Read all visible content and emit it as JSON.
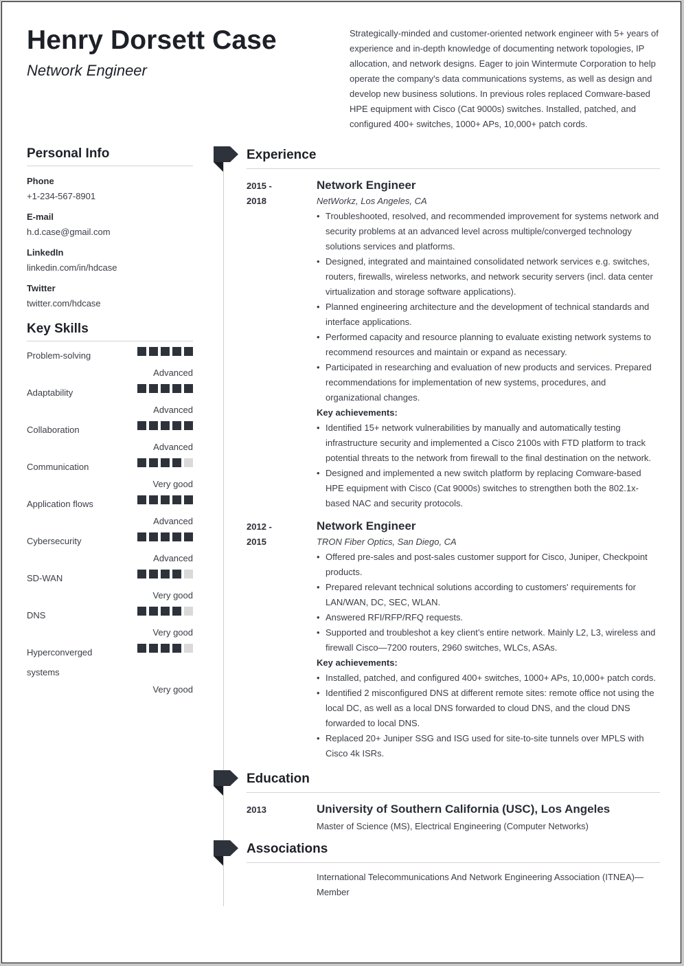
{
  "header": {
    "name": "Henry Dorsett Case",
    "title": "Network Engineer",
    "summary": "Strategically-minded and customer-oriented network engineer with 5+ years of experience and in-depth knowledge of documenting network topologies, IP allocation, and network designs. Eager to join Wintermute Corporation to help operate the company's data communications systems, as well as design and develop new business solutions. In previous roles replaced Comware-based HPE equipment with Cisco (Cat 9000s) switches. Installed, patched, and configured 400+ switches, 1000+ APs, 10,000+ patch cords."
  },
  "personal_info": {
    "heading": "Personal Info",
    "items": [
      {
        "label": "Phone",
        "value": "+1-234-567-8901"
      },
      {
        "label": "E-mail",
        "value": "h.d.case@gmail.com"
      },
      {
        "label": "LinkedIn",
        "value": "linkedin.com/in/hdcase"
      },
      {
        "label": "Twitter",
        "value": "twitter.com/hdcase"
      }
    ]
  },
  "skills": {
    "heading": "Key Skills",
    "max_level": 5,
    "items": [
      {
        "name": "Problem-solving",
        "level": 5,
        "label": "Advanced"
      },
      {
        "name": "Adaptability",
        "level": 5,
        "label": "Advanced"
      },
      {
        "name": "Collaboration",
        "level": 5,
        "label": "Advanced"
      },
      {
        "name": "Communication",
        "level": 4,
        "label": "Very good"
      },
      {
        "name": "Application flows",
        "level": 5,
        "label": "Advanced"
      },
      {
        "name": "Cybersecurity",
        "level": 5,
        "label": "Advanced"
      },
      {
        "name": "SD-WAN",
        "level": 4,
        "label": "Very good"
      },
      {
        "name": "DNS",
        "level": 4,
        "label": "Very good"
      },
      {
        "name": "Hyperconverged systems",
        "level": 4,
        "label": "Very good"
      }
    ]
  },
  "experience": {
    "heading": "Experience",
    "key_achievements_label": "Key achievements:",
    "jobs": [
      {
        "date_start": "2015 -",
        "date_end": "2018",
        "title": "Network Engineer",
        "company": "NetWorkz, Los Angeles, CA",
        "bullets": [
          "Troubleshooted, resolved, and recommended improvement for systems network and security problems at an advanced level across multiple/converged technology solutions services and platforms.",
          "Designed, integrated and maintained consolidated network services e.g. switches, routers, firewalls, wireless networks, and network security servers (incl. data center virtualization and storage software applications).",
          "Planned engineering architecture and the development of technical standards and interface applications.",
          "Performed capacity and resource planning to evaluate existing network systems to recommend resources and maintain or expand as necessary.",
          "Participated in researching and evaluation of new products and services. Prepared recommendations for implementation of new systems, procedures, and organizational changes."
        ],
        "achievements": [
          "Identified 15+ network vulnerabilities by manually and automatically testing infrastructure security and implemented a Cisco 2100s with FTD platform to track potential threats to the network from firewall to the final destination on the network.",
          "Designed and implemented a new switch platform by replacing Comware-based HPE equipment with Cisco (Cat 9000s) switches to strengthen both the 802.1x-based NAC and security protocols."
        ]
      },
      {
        "date_start": "2012 -",
        "date_end": "2015",
        "title": "Network Engineer",
        "company": "TRON Fiber Optics, San Diego, CA",
        "bullets": [
          "Offered pre-sales and post-sales customer support for Cisco, Juniper, Checkpoint products.",
          "Prepared relevant technical solutions according to customers' requirements for LAN/WAN, DC, SEC, WLAN.",
          "Answered RFI/RFP/RFQ requests.",
          "Supported and troubleshot a key client’s entire network. Mainly L2, L3, wireless and firewall Cisco—7200 routers, 2960 switches, WLCs, ASAs."
        ],
        "achievements": [
          "Installed, patched, and configured 400+ switches, 1000+ APs, 10,000+ patch cords.",
          "Identified 2 misconfigured DNS at different remote sites: remote office not using the local DC, as well as a local DNS forwarded to cloud DNS, and the cloud DNS forwarded to local DNS.",
          "Replaced 20+ Juniper SSG and ISG used for site-to-site tunnels over MPLS with Cisco 4k ISRs."
        ]
      }
    ]
  },
  "education": {
    "heading": "Education",
    "items": [
      {
        "date": "2013",
        "school": "University of Southern California (USC), Los Angeles",
        "degree": "Master of Science (MS), Electrical Engineering (Computer Networks)"
      }
    ]
  },
  "associations": {
    "heading": "Associations",
    "items": [
      "International Telecommunications And Network Engineering Association (ITNEA)—Member"
    ]
  },
  "colors": {
    "accent": "#2e323b",
    "skill_off": "#d9d9d9",
    "text": "#3a3d44",
    "heading": "#1e2028"
  }
}
